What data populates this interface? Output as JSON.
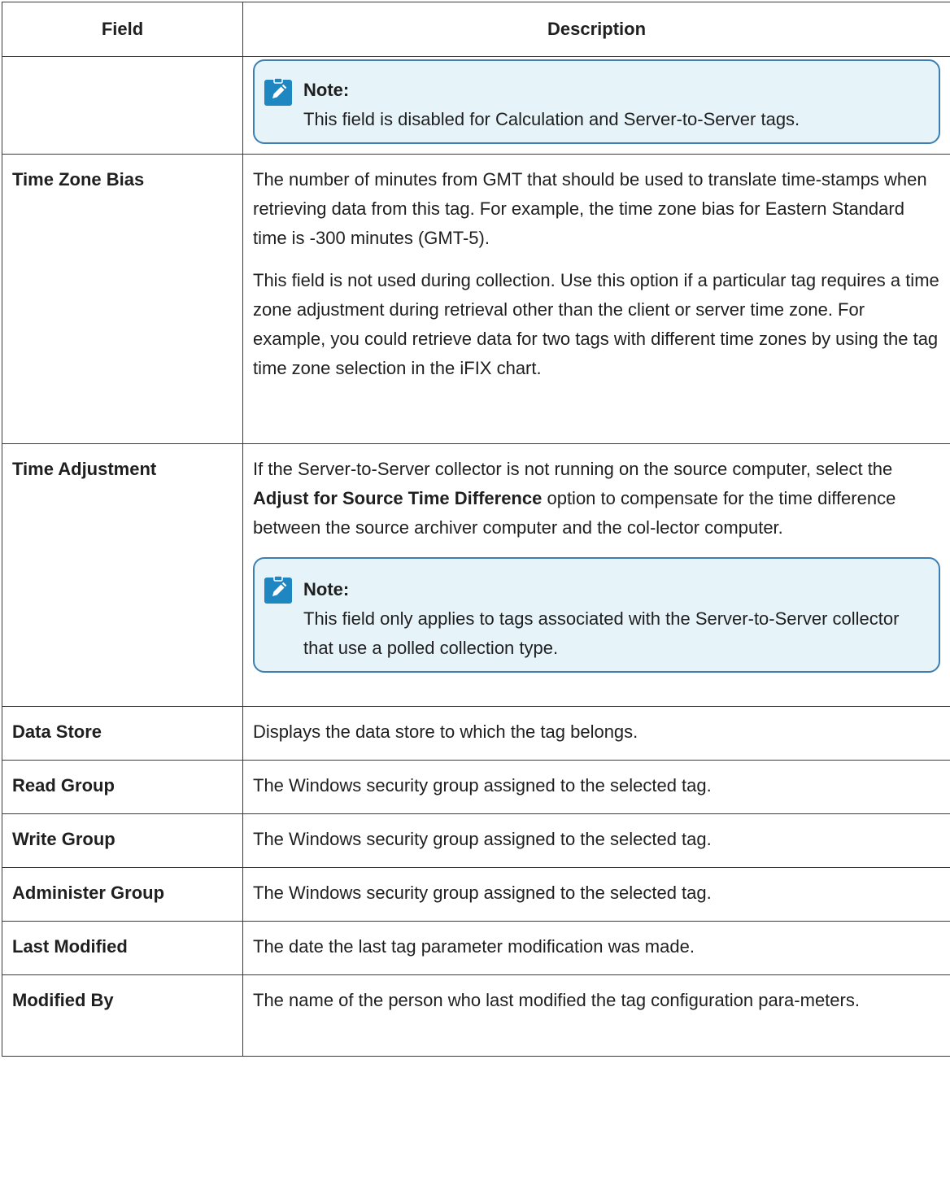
{
  "table": {
    "headers": [
      "Field",
      "Description"
    ],
    "rows": [
      {
        "field": "",
        "note": {
          "title": "Note:",
          "text": "This field is disabled for Calculation and Server-to-Server tags."
        }
      },
      {
        "field": "Time Zone Bias",
        "paragraphs": [
          "The number of minutes from GMT that should be used to translate time-stamps when retrieving data from this tag. For example, the time zone bias for Eastern Standard time is -300 minutes (GMT-5).",
          "This field is not used during collection. Use this option if a particular tag requires a time zone adjustment during retrieval other than the client or server time zone. For example, you could retrieve data for two tags with different time zones by using the tag time zone selection in the iFIX chart."
        ]
      },
      {
        "field": "Time Adjustment",
        "para_before": "If the Server-to-Server collector is not running on the source computer, select the",
        "para_bold": "Adjust for Source Time Difference",
        "para_after": "option to compensate for the time difference between the source archiver computer and the col-lector computer.",
        "note": {
          "title": "Note:",
          "text": "This field only applies to tags associated with the Server-to-Server collector that use a polled collection type."
        }
      },
      {
        "field": "Data Store",
        "description": "Displays the data store to which the tag belongs."
      },
      {
        "field": "Read Group",
        "description": "The Windows security group assigned to the selected tag."
      },
      {
        "field": "Write Group",
        "description": "The Windows security group assigned to the selected tag."
      },
      {
        "field": "Administer Group",
        "description": "The Windows security group assigned to the selected tag."
      },
      {
        "field": "Last Modified",
        "description": "The date the last tag parameter modification was made."
      },
      {
        "field": "Modified By",
        "description": "The name of the person who last modified the tag configuration para-meters."
      }
    ]
  },
  "icons": {
    "note": "pencil-note-icon"
  },
  "colors": {
    "note_bg": "#e6f4fa",
    "note_border": "#3d7fb3",
    "icon": "#1e86c1"
  }
}
